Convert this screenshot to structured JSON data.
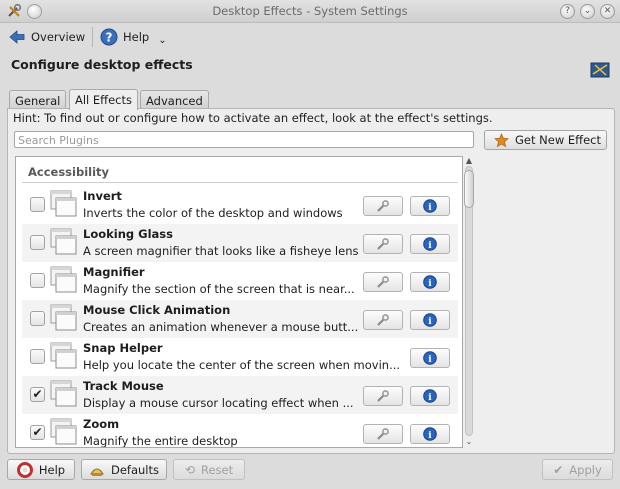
{
  "window": {
    "title": "Desktop Effects - System Settings"
  },
  "toolbar": {
    "overview_label": "Overview",
    "help_label": "Help"
  },
  "page": {
    "heading": "Configure desktop effects"
  },
  "tabs": [
    {
      "label": "General"
    },
    {
      "label": "All Effects"
    },
    {
      "label": "Advanced"
    }
  ],
  "hint": "Hint: To find out or configure how to activate an effect, look at the effect's settings.",
  "search": {
    "placeholder": "Search Plugins"
  },
  "get_new_button": "Get New Effect",
  "category": "Accessibility",
  "effects": [
    {
      "name": "Invert",
      "description": "Inverts the color of the desktop and windows",
      "checked": false,
      "configurable": true
    },
    {
      "name": "Looking Glass",
      "description": "A screen magnifier that looks like a fisheye lens",
      "checked": false,
      "configurable": true
    },
    {
      "name": "Magnifier",
      "description": "Magnify the section of the screen that is near...",
      "checked": false,
      "configurable": true
    },
    {
      "name": "Mouse Click Animation",
      "description": "Creates an animation whenever a mouse butt...",
      "checked": false,
      "configurable": true
    },
    {
      "name": "Snap Helper",
      "description": "Help you locate the center of the screen when movin...",
      "checked": false,
      "configurable": false
    },
    {
      "name": "Track Mouse",
      "description": "Display a mouse cursor locating effect when ...",
      "checked": true,
      "configurable": true
    },
    {
      "name": "Zoom",
      "description": "Magnify the entire desktop",
      "checked": true,
      "configurable": true
    }
  ],
  "bottom": {
    "help": "Help",
    "defaults": "Defaults",
    "reset": "Reset",
    "apply": "Apply"
  },
  "colors": {
    "info_blue": "#2a64c0",
    "star_orange": "#e08a1e"
  }
}
